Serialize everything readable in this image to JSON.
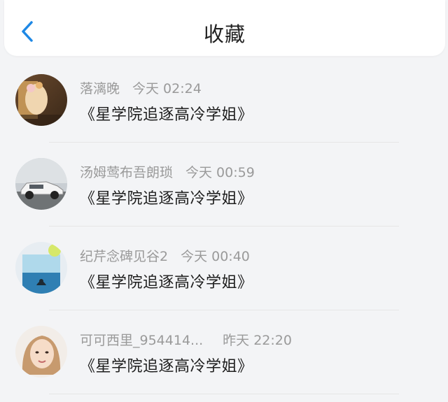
{
  "header": {
    "title": "收藏",
    "back_icon": "chevron-left-icon",
    "accent_color": "#1e88e5"
  },
  "items": [
    {
      "user": "落漓晚",
      "time": "今天 02:24",
      "book": "《星学院追逐高冷学姐》",
      "avatar_icon": "person-photo-avatar"
    },
    {
      "user": "汤姆莺布吾朗琐",
      "time": "今天 00:59",
      "book": "《星学院追逐高冷学姐》",
      "avatar_icon": "car-photo-avatar"
    },
    {
      "user": "纪芹念碑见谷2",
      "time": "今天 00:40",
      "book": "《星学院追逐高冷学姐》",
      "avatar_icon": "drink-photo-avatar"
    },
    {
      "user": "可可西里_954414...",
      "time": "昨天 22:20",
      "book": "《星学院追逐高冷学姐》",
      "avatar_icon": "woman-photo-avatar"
    }
  ]
}
